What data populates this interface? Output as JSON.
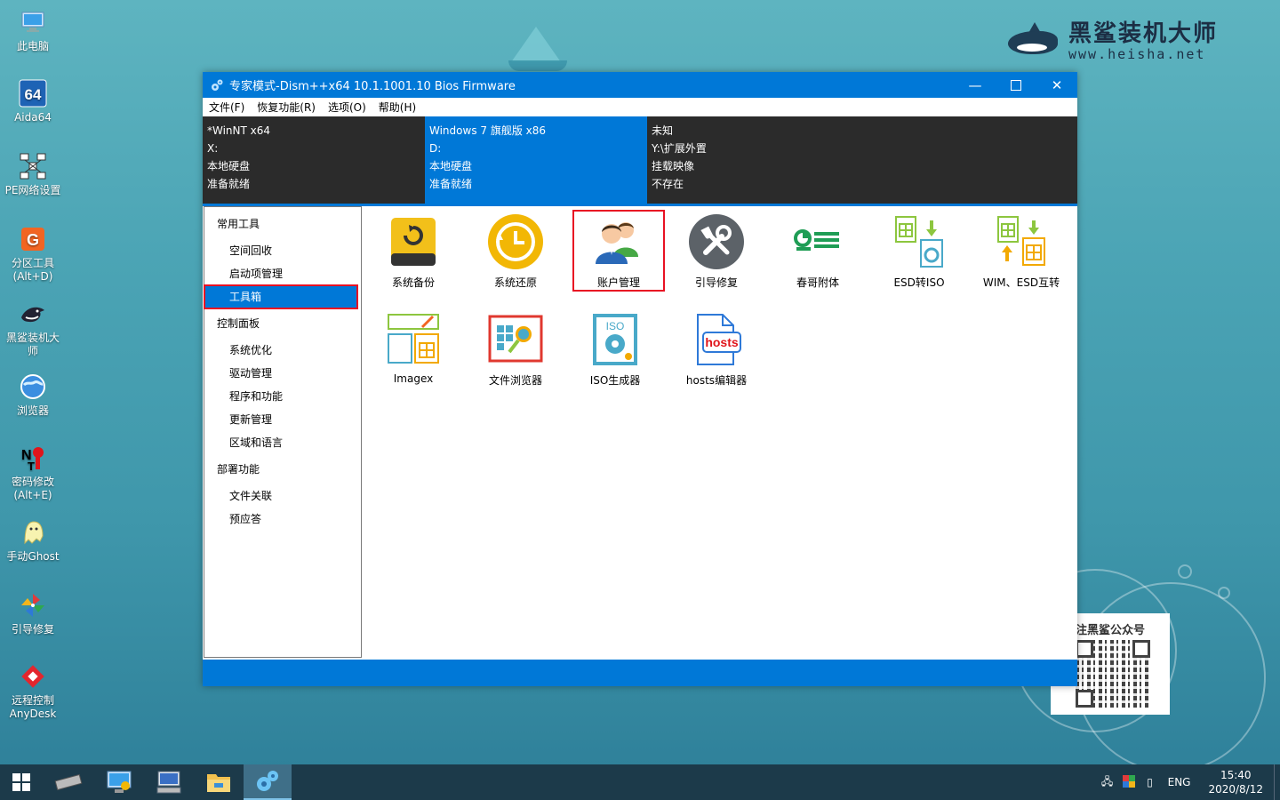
{
  "desktop": {
    "icons": [
      {
        "label": "此电脑"
      },
      {
        "label": "Aida64"
      },
      {
        "label": "PE网络设置"
      },
      {
        "label": "分区工具\n(Alt+D)"
      },
      {
        "label": "黑鲨装机大师"
      },
      {
        "label": "浏览器"
      },
      {
        "label": "密码修改\n(Alt+E)"
      },
      {
        "label": "手动Ghost"
      },
      {
        "label": "引导修复"
      },
      {
        "label": "远程控制\nAnyDesk"
      }
    ],
    "brand": {
      "name": "黑鲨装机大师",
      "url": "www.heisha.net"
    },
    "qr_caption": "注黑鲨公众号"
  },
  "window": {
    "title": "专家模式-Dism++x64 10.1.1001.10 Bios Firmware",
    "menu": [
      "文件(F)",
      "恢复功能(R)",
      "选项(O)",
      "帮助(H)"
    ],
    "info_columns": [
      {
        "lines": [
          "*WinNT x64",
          "X:",
          "本地硬盘",
          "准备就绪"
        ]
      },
      {
        "lines": [
          "Windows 7 旗舰版 x86",
          "D:",
          "本地硬盘",
          "准备就绪"
        ]
      },
      {
        "lines": [
          "未知",
          "Y:\\扩展外置",
          "挂载映像",
          "不存在"
        ]
      }
    ],
    "nav": {
      "group1": "常用工具",
      "group1_items": [
        "空间回收",
        "启动项管理",
        "工具箱"
      ],
      "group2": "控制面板",
      "group2_items": [
        "系统优化",
        "驱动管理",
        "程序和功能",
        "更新管理",
        "区域和语言"
      ],
      "group3": "部署功能",
      "group3_items": [
        "文件关联",
        "预应答"
      ]
    },
    "tools": [
      "系统备份",
      "系统还原",
      "账户管理",
      "引导修复",
      "春哥附体",
      "ESD转ISO",
      "WIM、ESD互转",
      "Imagex",
      "文件浏览器",
      "ISO生成器",
      "hosts编辑器"
    ],
    "hosts_icon_text": "hosts",
    "iso_icon_text": "ISO"
  },
  "taskbar": {
    "lang": "ENG",
    "time": "15:40",
    "date": "2020/8/12"
  },
  "colors": {
    "accent": "#0078d7",
    "highlight": "#e81123",
    "info_bg": "#2b2b2b"
  }
}
